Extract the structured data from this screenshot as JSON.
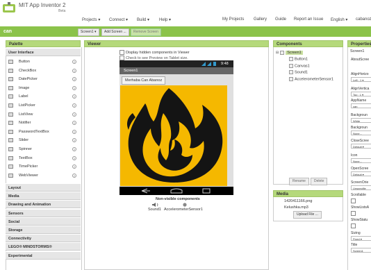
{
  "header": {
    "brand_line1": "MIT App Inventor 2",
    "brand_line2": "Beta",
    "menus": [
      "Projects ▾",
      "Connect ▾",
      "Build ▾",
      "Help ▾"
    ],
    "right_links": [
      "My Projects",
      "Gallery",
      "Guide",
      "Report an Issue",
      "English ▾",
      "cabanoz"
    ]
  },
  "project": {
    "name": "can",
    "screen_select": "Screen1 ▾",
    "add_screen": "Add Screen ...",
    "remove_screen": "Remove Screen"
  },
  "palette": {
    "title": "Palette",
    "categories_top": "User Interface",
    "items": [
      "Button",
      "CheckBox",
      "DatePicker",
      "Image",
      "Label",
      "ListPicker",
      "ListView",
      "Notifier",
      "PasswordTextBox",
      "Slider",
      "Spinner",
      "TextBox",
      "TimePicker",
      "WebViewer"
    ],
    "help_glyph": "?",
    "categories_bottom": [
      "Layout",
      "Media",
      "Drawing and Animation",
      "Sensors",
      "Social",
      "Storage",
      "Connectivity",
      "LEGO® MINDSTORMS®",
      "Experimental"
    ]
  },
  "viewer": {
    "title": "Viewer",
    "check1": "Display hidden components in Viewer",
    "check2": "Check to see Preview on Tablet size.",
    "time": "9:48",
    "screen_title": "Screen1",
    "button_text": "Merhaba Can Abanoz",
    "nonvisible_title": "Non-visible components",
    "nonvisible": [
      "Sound1",
      "AccelerometerSensor1"
    ]
  },
  "components": {
    "title": "Components",
    "tree": [
      "Screen1",
      "Button1",
      "Canvas1",
      "Sound1",
      "AccelerometerSensor1"
    ],
    "rename": "Rename",
    "delete": "Delete"
  },
  "media": {
    "title": "Media",
    "files": [
      "1420411166.png",
      "Kelushka.mp3"
    ],
    "upload": "Upload File ..."
  },
  "properties": {
    "title": "Properties",
    "screen": "Screen1",
    "rows": [
      {
        "label": "AboutScree",
        "value": ""
      },
      {
        "label": "AlignHorizo",
        "value": "Left : 1 ▾"
      },
      {
        "label": "AlignVertica",
        "value": "Top : 1 ▾"
      },
      {
        "label": "AppName",
        "value": "can"
      },
      {
        "label": "Backgroun",
        "value": "White"
      },
      {
        "label": "Backgroun",
        "value": "None..."
      },
      {
        "label": "CloseScree",
        "value": "Default ▾"
      },
      {
        "label": "Icon",
        "value": "None..."
      },
      {
        "label": "OpenScree",
        "value": "Default ▾"
      },
      {
        "label": "ScreenOrie",
        "value": "Unspecifie"
      },
      {
        "label": "Scrollable",
        "value": ""
      },
      {
        "label": "ShowListsA",
        "value": ""
      },
      {
        "label": "ShowStatu",
        "value": ""
      },
      {
        "label": "Sizing",
        "value": "Fixed ▾"
      },
      {
        "label": "Title",
        "value": "Screen1"
      }
    ]
  },
  "colors": {
    "accent": "#8bc34a",
    "panel_header": "#b5d97b",
    "canvas": "#f5b800"
  }
}
